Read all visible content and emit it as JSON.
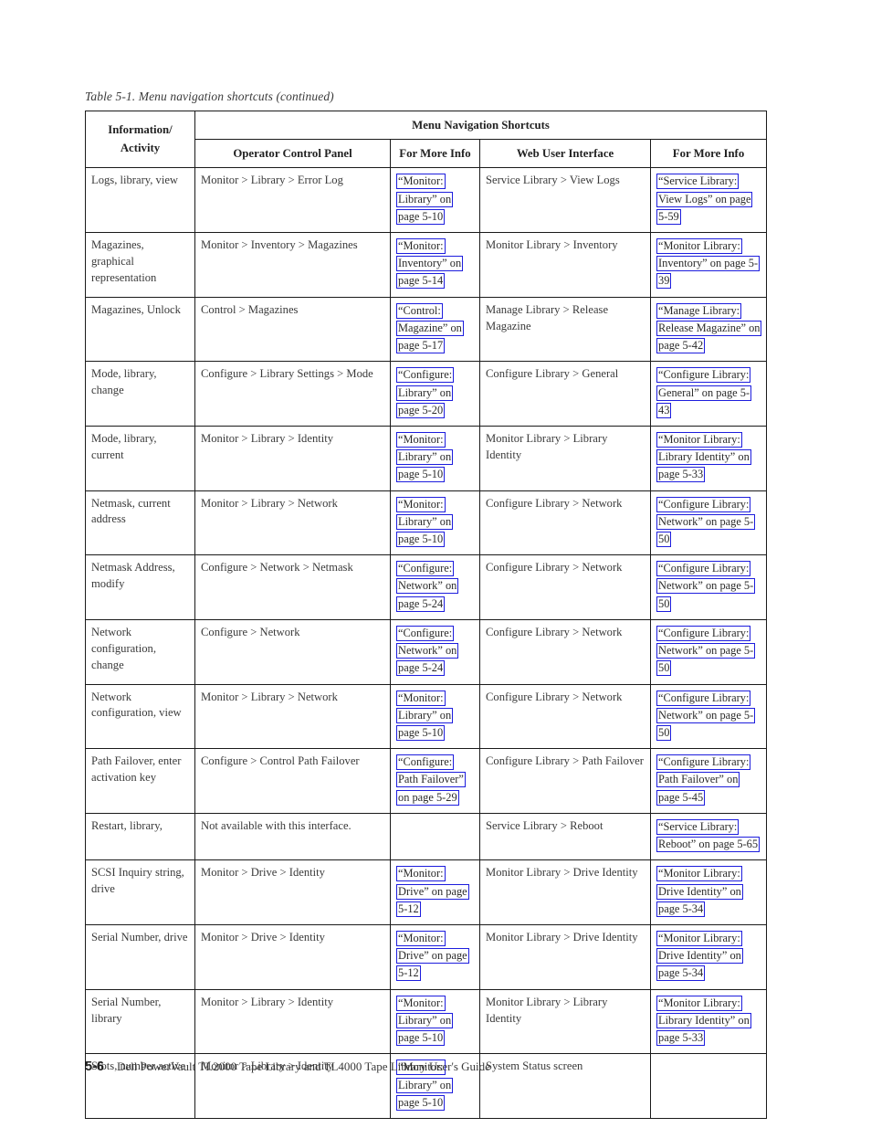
{
  "caption": "Table 5-1. Menu navigation shortcuts  (continued)",
  "header": {
    "info_activity": "Information/\nActivity",
    "group_title": "Menu Navigation Shortcuts",
    "col_ocp": "Operator Control Panel",
    "col_more_info_1": "For More Info",
    "col_web": "Web User Interface",
    "col_more_info_2": "For More Info"
  },
  "rows": [
    {
      "activity": "Logs, library, view",
      "ocp": "Monitor > Library > Error Log",
      "ocp_ref": "“Monitor: Library” on page 5-10",
      "web": "Service Library > View Logs",
      "web_ref": "“Service Library: View Logs” on page 5-59"
    },
    {
      "activity": "Magazines, graphical representation",
      "ocp": "Monitor > Inventory > Magazines",
      "ocp_ref": "“Monitor: Inventory” on page 5-14",
      "web": "Monitor Library > Inventory",
      "web_ref": "“Monitor Library: Inventory” on page 5-39"
    },
    {
      "activity": "Magazines, Unlock",
      "ocp": "Control > Magazines",
      "ocp_ref": "“Control: Magazine” on page 5-17",
      "web": "Manage Library > Release Magazine",
      "web_ref": "“Manage Library: Release Magazine” on page 5-42"
    },
    {
      "activity": "Mode, library, change",
      "ocp": "Configure > Library Settings > Mode",
      "ocp_ref": "“Configure: Library” on page 5-20",
      "web": "Configure Library > General",
      "web_ref": "“Configure Library: General” on page 5-43"
    },
    {
      "activity": "Mode, library, current",
      "ocp": "Monitor > Library > Identity",
      "ocp_ref": "“Monitor: Library” on page 5-10",
      "web": "Monitor Library > Library Identity",
      "web_ref": "“Monitor Library: Library Identity” on page 5-33"
    },
    {
      "activity": "Netmask, current address",
      "ocp": "Monitor > Library > Network",
      "ocp_ref": "“Monitor: Library” on page 5-10",
      "web": "Configure Library > Network",
      "web_ref": "“Configure Library: Network” on page 5-50"
    },
    {
      "activity": "Netmask Address, modify",
      "ocp": "Configure > Network > Netmask",
      "ocp_ref": "“Configure: Network” on page 5-24",
      "web": "Configure Library > Network",
      "web_ref": "“Configure Library: Network” on page 5-50"
    },
    {
      "activity": "Network configuration, change",
      "ocp": "Configure > Network",
      "ocp_ref": "“Configure: Network” on page 5-24",
      "web": "Configure Library > Network",
      "web_ref": "“Configure Library: Network” on page 5-50"
    },
    {
      "activity": "Network configuration, view",
      "ocp": "Monitor > Library > Network",
      "ocp_ref": "“Monitor: Library” on page 5-10",
      "web": "Configure Library > Network",
      "web_ref": "“Configure Library: Network” on page 5-50"
    },
    {
      "activity": "Path Failover, enter activation key",
      "ocp": "Configure > Control Path Failover",
      "ocp_ref": "“Configure: Path Failover” on page 5-29",
      "web": "Configure Library > Path Failover",
      "web_ref": "“Configure Library: Path Failover” on page 5-45"
    },
    {
      "activity": "Restart, library,",
      "ocp": "Not available with this interface.",
      "ocp_plain": true,
      "ocp_ref": "",
      "web": "Service Library > Reboot",
      "web_ref": "“Service Library: Reboot” on page 5-65"
    },
    {
      "activity": "SCSI Inquiry string, drive",
      "ocp": "Monitor > Drive > Identity",
      "ocp_ref": "“Monitor: Drive” on page 5-12",
      "web": "Monitor Library > Drive Identity",
      "web_ref": "“Monitor Library: Drive Identity” on page 5-34"
    },
    {
      "activity": "Serial Number, drive",
      "ocp": "Monitor > Drive > Identity",
      "ocp_ref": "“Monitor: Drive” on page 5-12",
      "web": "Monitor Library > Drive Identity",
      "web_ref": "“Monitor Library: Drive Identity” on page 5-34"
    },
    {
      "activity": "Serial Number, library",
      "ocp": "Monitor > Library > Identity",
      "ocp_ref": "“Monitor: Library” on page 5-10",
      "web": "Monitor Library > Library Identity",
      "web_ref": "“Monitor Library: Library Identity” on page 5-33"
    },
    {
      "activity": "Slots, number active",
      "ocp": "Monitor > Library > Identity",
      "ocp_ref": "“Monitor: Library” on page 5-10",
      "web": "System Status screen",
      "web_ref": ""
    }
  ],
  "footer": {
    "page_number": "5-6",
    "book_title": "Dell PowerVault TL2000 Tape Library and TL4000 Tape Library User's Guide"
  },
  "colors": {
    "link_border": "#1d1ddd",
    "text": "#3a3a3a",
    "rule": "#1a1a1a"
  }
}
